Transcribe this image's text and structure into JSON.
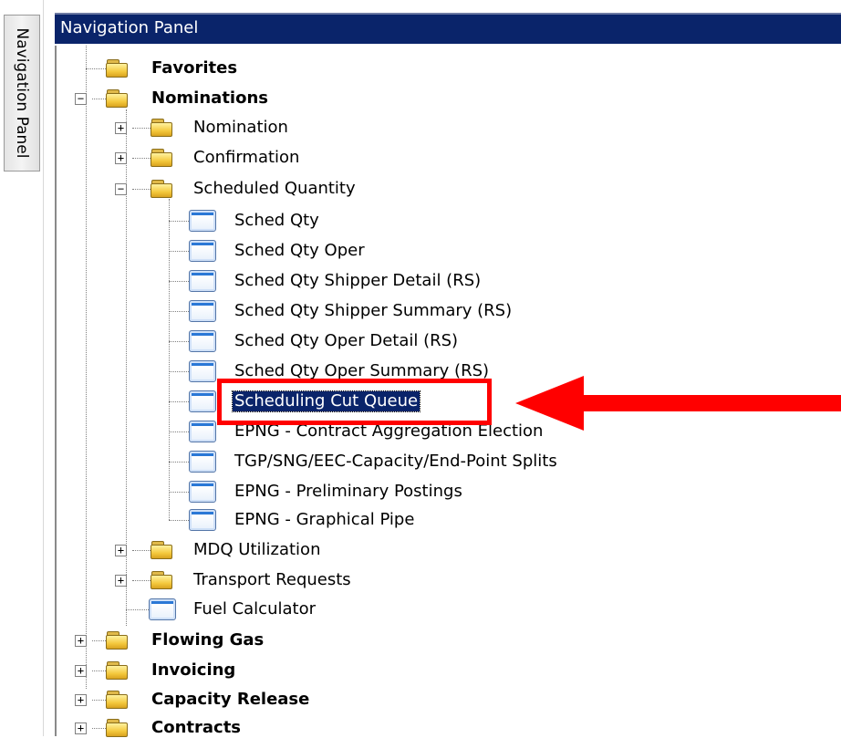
{
  "side_tab": {
    "label": "Navigation Panel"
  },
  "header": {
    "title": "Navigation Panel"
  },
  "tree": {
    "favorites": "Favorites",
    "nominations": "Nominations",
    "nomination": "Nomination",
    "confirmation": "Confirmation",
    "scheduled_quantity": "Scheduled Quantity",
    "sched_qty": "Sched Qty",
    "sched_qty_oper": "Sched Qty Oper",
    "sched_qty_shipper_detail": "Sched Qty Shipper Detail (RS)",
    "sched_qty_shipper_summary": "Sched Qty Shipper Summary (RS)",
    "sched_qty_oper_detail": "Sched Qty Oper Detail (RS)",
    "sched_qty_oper_summary": "Sched Qty Oper Summary (RS)",
    "scheduling_cut_queue": "Scheduling Cut Queue",
    "epng_contract_aggregation": "EPNG - Contract Aggregation Election",
    "tgp_capacity_splits": "TGP/SNG/EEC-Capacity/End-Point Splits",
    "epng_preliminary_postings": "EPNG - Preliminary Postings",
    "epng_graphical_pipe": "EPNG - Graphical Pipe",
    "mdq_utilization": "MDQ Utilization",
    "transport_requests": "Transport Requests",
    "fuel_calculator": "Fuel Calculator",
    "flowing_gas": "Flowing Gas",
    "invoicing": "Invoicing",
    "capacity_release": "Capacity Release",
    "contracts": "Contracts"
  },
  "colors": {
    "header_bg": "#0a246a",
    "selection_bg": "#0a246a",
    "annotation_red": "#ff0000"
  }
}
